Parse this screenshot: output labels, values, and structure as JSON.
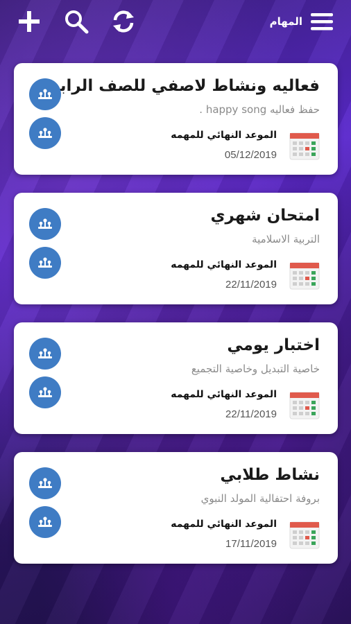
{
  "header": {
    "title": "المهام",
    "icons": [
      "add-icon",
      "search-icon",
      "refresh-icon",
      "menu-icon"
    ]
  },
  "cards": [
    {
      "title": "فعاليه ونشاط لاصفي للصف الرابع",
      "subtitle": "حفظ فعاليه happy song .",
      "deadline_label": "الموعد النهائي للمهمه",
      "deadline_date": "05/12/2019"
    },
    {
      "title": "امتحان شهري",
      "subtitle": "التربية الاسلامية",
      "deadline_label": "الموعد النهائي للمهمه",
      "deadline_date": "22/11/2019"
    },
    {
      "title": "اختبار يومي",
      "subtitle": "خاصية التبديل وخاصية التجميع",
      "deadline_label": "الموعد النهائي للمهمه",
      "deadline_date": "22/11/2019"
    },
    {
      "title": "نشاط طلابي",
      "subtitle": "بروفة احتفالية المولد النبوي",
      "deadline_label": "الموعد النهائي للمهمه",
      "deadline_date": "17/11/2019"
    }
  ],
  "colors": {
    "accent_blue": "#3f7cc4",
    "calendar_red": "#e05a4c",
    "calendar_green": "#3aa55a"
  }
}
